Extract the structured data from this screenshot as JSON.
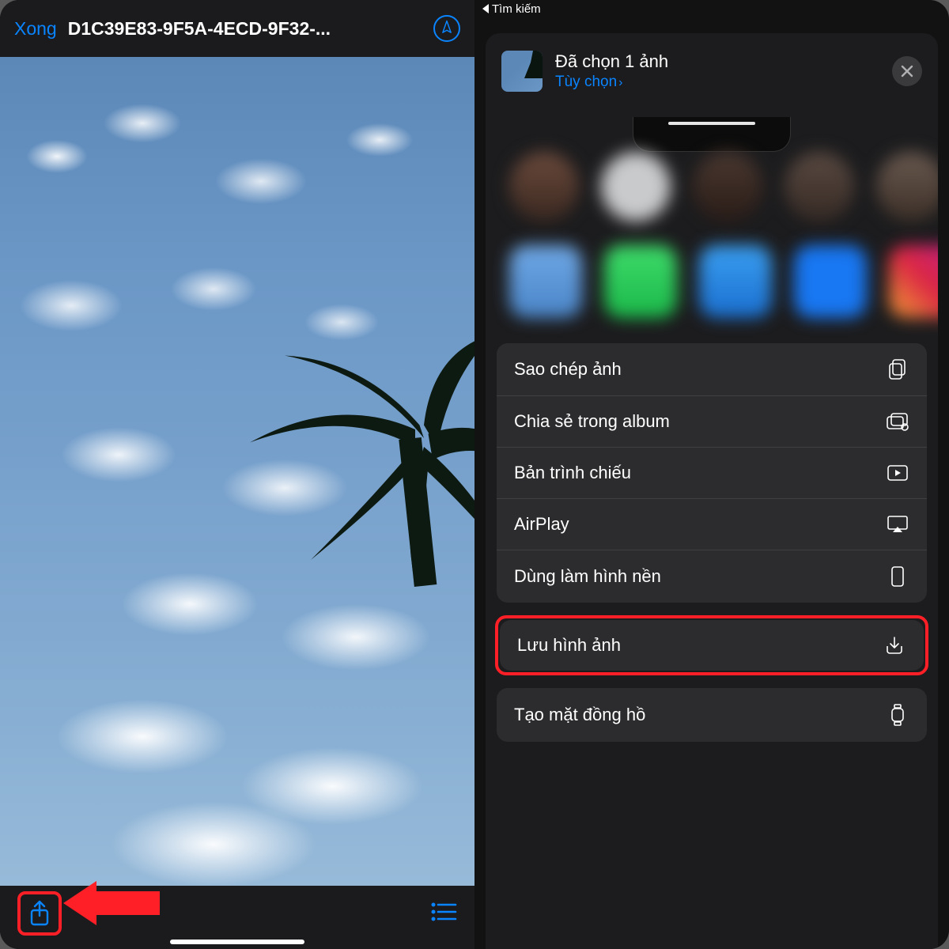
{
  "left": {
    "done": "Xong",
    "filename": "D1C39E83-9F5A-4ECD-9F32-..."
  },
  "right": {
    "back_top": "Tìm kiếm",
    "selected_title": "Đã chọn 1 ảnh",
    "options_label": "Tùy chọn",
    "actions_group": [
      "Sao chép ảnh",
      "Chia sẻ trong album",
      "Bản trình chiếu",
      "AirPlay",
      "Dùng làm hình nền"
    ],
    "save_action": "Lưu hình ảnh",
    "watchface_action": "Tạo mặt đồng hồ"
  }
}
